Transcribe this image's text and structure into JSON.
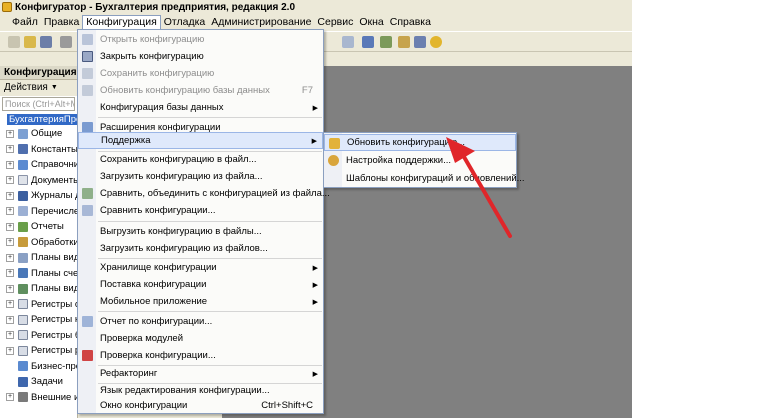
{
  "window": {
    "title": "Конфигуратор - Бухгалтерия предприятия, редакция 2.0"
  },
  "menubar": {
    "items": [
      "Файл",
      "Правка",
      "Конфигурация",
      "Отладка",
      "Администрирование",
      "Сервис",
      "Окна",
      "Справка"
    ],
    "active": "Конфигурация"
  },
  "left_panel": {
    "title": "Конфигурация",
    "actions_label": "Действия",
    "search_placeholder": "Поиск (Ctrl+Alt+M)",
    "root": "БухгалтерияПре",
    "items": [
      "Общие",
      "Константы",
      "Справочник",
      "Документы",
      "Журналы до",
      "Перечислен",
      "Отчеты",
      "Обработки",
      "Планы видо",
      "Планы счет",
      "Планы видо",
      "Регистры св",
      "Регистры на",
      "Регистры бу",
      "Регистры ра",
      "Бизнес-проц",
      "Задачи",
      "Внешние ис"
    ]
  },
  "config_menu": {
    "open": "Открыть конфигурацию",
    "close": "Закрыть конфигурацию",
    "save": "Сохранить конфигурацию",
    "update_db": "Обновить конфигурацию базы данных",
    "update_db_shortcut": "F7",
    "db_config": "Конфигурация базы данных",
    "extensions": "Расширения конфигурации",
    "support": "Поддержка",
    "save_to_file": "Сохранить конфигурацию в файл...",
    "load_from_file": "Загрузить конфигурацию из файла...",
    "compare_merge": "Сравнить, объединить с конфигурацией из файла...",
    "compare": "Сравнить конфигурации...",
    "dump_to_files": "Выгрузить конфигурацию в файлы...",
    "load_from_files": "Загрузить конфигурацию из файлов...",
    "storage": "Хранилище конфигурации",
    "delivery": "Поставка конфигурации",
    "mobile": "Мобильное приложение",
    "report": "Отчет по конфигурации...",
    "check_modules": "Проверка модулей",
    "check_config": "Проверка конфигурации...",
    "refactoring": "Рефакторинг",
    "edit_language": "Язык редактирования конфигурации...",
    "config_window": "Окно конфигурации",
    "config_window_shortcut": "Ctrl+Shift+C"
  },
  "support_submenu": {
    "update": "Обновить конфигурацию...",
    "settings": "Настройка поддержки...",
    "templates": "Шаблоны конфигураций и обновлений..."
  },
  "colors": {
    "menu_highlight": "#dfe9fb",
    "annotation_arrow": "#e0262a",
    "selection": "#3169c6"
  }
}
